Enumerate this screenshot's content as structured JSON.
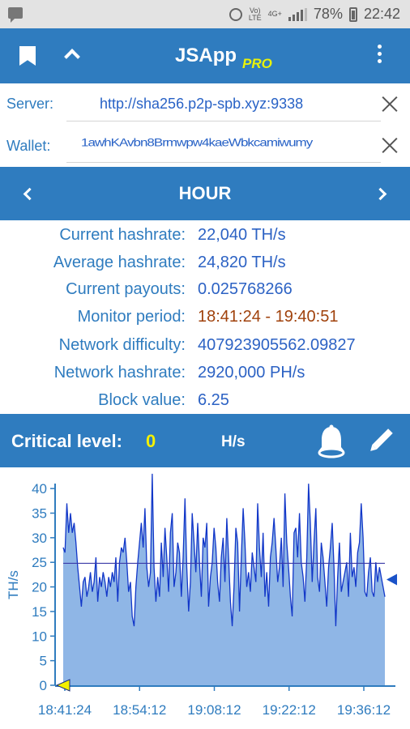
{
  "status_bar": {
    "battery": "78%",
    "time": "22:42",
    "volte": "Vo)\nLTE",
    "network": "4G+"
  },
  "app_bar": {
    "title": "JSApp",
    "badge": "PRO"
  },
  "connection": {
    "server_label": "Server:",
    "server_value": "http://sha256.p2p-spb.xyz:9338",
    "wallet_label": "Wallet:",
    "wallet_value": "1awhKAvbn8Brmwpw4kaeWbkcamiwumy"
  },
  "period": {
    "title": "HOUR"
  },
  "stats": [
    {
      "label": "Current hashrate:",
      "value": "22,040 TH/s"
    },
    {
      "label": "Average hashrate:",
      "value": "24,820 TH/s"
    },
    {
      "label": "Current payouts:",
      "value": "0.025768266"
    },
    {
      "label": "Monitor period:",
      "value": "18:41:24 - 19:40:51"
    },
    {
      "label": "Network difficulty:",
      "value": "407923905562.09827"
    },
    {
      "label": "Network hashrate:",
      "value": "2920,000 PH/s"
    },
    {
      "label": "Block value:",
      "value": "6.25"
    }
  ],
  "critical": {
    "label": "Critical level:",
    "value": "0",
    "unit": "H/s"
  },
  "colors": {
    "primary": "#2f7cbf",
    "value_text": "#2c62c4",
    "period_value": "#a0420c",
    "critical_value": "#f4f100",
    "chart_fill": "#8fb6e6",
    "chart_line": "#1237c8"
  },
  "chart_data": {
    "type": "area",
    "ylabel": "TH/s",
    "ylim": [
      0,
      42
    ],
    "yticks": [
      0,
      5,
      10,
      15,
      20,
      25,
      30,
      35,
      40
    ],
    "xtick_labels": [
      "18:41:24",
      "18:54:12",
      "19:08:12",
      "19:22:12",
      "19:36:12"
    ],
    "average_line": 24.8,
    "critical_marker": 0,
    "current_marker": 21.5,
    "series": [
      {
        "values": [
          28,
          27,
          37,
          31,
          35,
          31,
          33,
          29,
          24,
          20,
          16,
          21,
          22,
          18,
          20,
          23,
          19,
          21,
          26,
          17,
          22,
          20,
          23,
          21,
          18,
          22,
          20,
          23,
          21,
          26,
          17,
          25,
          28,
          27,
          30,
          25,
          19,
          21,
          14,
          12,
          20,
          25,
          29,
          33,
          28,
          36,
          24,
          20,
          23,
          43,
          24,
          17,
          22,
          18,
          29,
          22,
          32,
          26,
          19,
          31,
          35,
          20,
          23,
          29,
          27,
          18,
          26,
          38,
          24,
          15,
          21,
          35,
          29,
          23,
          33,
          25,
          18,
          30,
          28,
          33,
          16,
          22,
          25,
          32,
          28,
          21,
          17,
          26,
          30,
          21,
          34,
          26,
          17,
          12,
          20,
          32,
          29,
          15,
          26,
          36,
          29,
          20,
          23,
          19,
          27,
          24,
          21,
          37,
          28,
          22,
          31,
          18,
          23,
          16,
          26,
          29,
          34,
          28,
          21,
          24,
          30,
          20,
          39,
          29,
          24,
          18,
          14,
          31,
          32,
          26,
          35,
          25,
          22,
          17,
          26,
          41,
          33,
          21,
          29,
          36,
          22,
          19,
          29,
          26,
          21,
          16,
          24,
          28,
          33,
          24,
          12,
          22,
          29,
          19,
          21,
          23,
          25,
          18,
          31,
          22,
          24,
          20,
          27,
          29,
          37,
          30,
          19,
          18,
          23,
          26,
          19,
          18,
          25,
          21,
          24,
          22,
          20,
          18
        ]
      }
    ]
  }
}
